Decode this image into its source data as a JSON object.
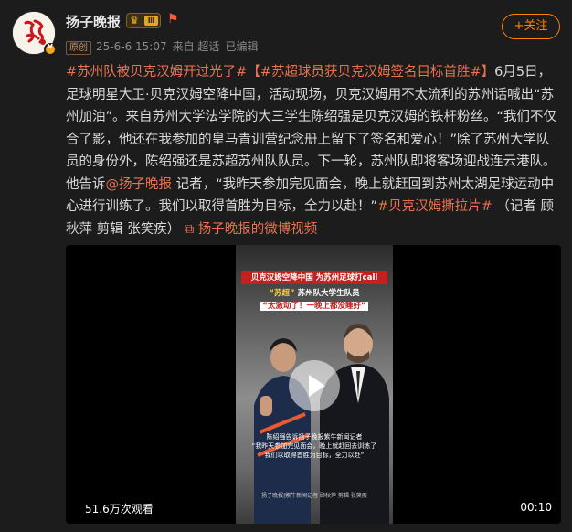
{
  "author": {
    "name": "扬子晚报",
    "avatar_text": "扬子晚报",
    "verified": true,
    "member_level": "Ⅲ"
  },
  "meta": {
    "original_tag": "原创",
    "date": "25-6-6 15:07",
    "source": "来自 超话",
    "edited": "已编辑"
  },
  "follow_button": "+关注",
  "post": {
    "tag1": "#苏州队被贝克汉姆开过光了#",
    "tag2": "【#苏超球员获贝克汉姆签名目标首胜#】",
    "body1": "6月5日，足球明星大卫·贝克汉姆空降中国，活动现场，贝克汉姆用不太流利的苏州话喊出“苏州加油”。来自苏州大学法学院的大三学生陈绍强是贝克汉姆的铁杆粉丝。“我们不仅合了影，他还在我参加的皇马青训营纪念册上留下了签名和爱心！”除了苏州大学队员的身份外，陈绍强还是苏超苏州队队员。下一轮，苏州队即将客场迎战连云港队。他告诉",
    "mention": "@扬子晚报",
    "body2": " 记者，“我昨天参加完见面会，晚上就赶回到苏州太湖足球运动中心进行训练了。我们以取得首胜为目标，全力以赴！”",
    "tag3": "#贝克汉姆撕拉片#",
    "credits": " （记者 顾秋萍 剪辑 张笑疾） ",
    "video_link": "扬子晚报的微博视频"
  },
  "video": {
    "title_bar": "贝克汉姆空降中国 为苏州足球打call",
    "sub1_a": "“苏超”",
    "sub1_b": "苏州队大学生队员",
    "sub2": "“太激动了！一晚上都没睡好”",
    "caption1": "陈绍强告诉扬子晚报紫牛新闻记者",
    "caption2": "“我昨天参加完见面会，晚上就赶回去训练了",
    "caption3": "我们以取得首胜为目标，全力以赴”",
    "caption4": "扬子晚报|紫牛新闻记者 顾秋萍  剪辑 张笑疾",
    "views": "51.6万次观看",
    "duration": "00:10"
  },
  "colors": {
    "accent": "#eb7350",
    "follow": "#ff8200",
    "background": "#1c1c1c"
  }
}
